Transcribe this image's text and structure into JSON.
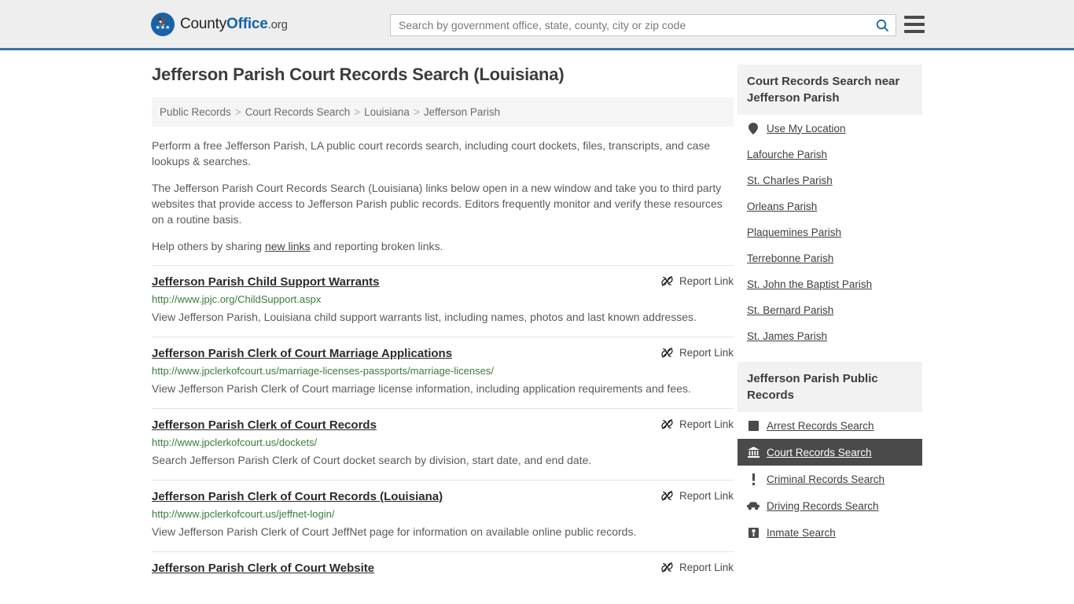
{
  "header": {
    "logo": {
      "prefix": "County",
      "bold": "Office",
      "tld": ".org",
      "icon": "eagle-logo-icon"
    },
    "search": {
      "placeholder": "Search by government office, state, county, city or zip code",
      "value": ""
    },
    "menu_label": "menu"
  },
  "page": {
    "title": "Jefferson Parish Court Records Search (Louisiana)"
  },
  "breadcrumb": [
    "Public Records",
    "Court Records Search",
    "Louisiana",
    "Jefferson Parish"
  ],
  "intro": {
    "p1": "Perform a free Jefferson Parish, LA public court records search, including court dockets, files, transcripts, and case lookups & searches.",
    "p2": "The Jefferson Parish Court Records Search (Louisiana) links below open in a new window and take you to third party websites that provide access to Jefferson Parish public records. Editors frequently monitor and verify these resources on a routine basis.",
    "p3_before": "Help others by sharing ",
    "p3_link": "new links",
    "p3_after": " and reporting broken links."
  },
  "report_link_label": "Report Link",
  "results": [
    {
      "title": "Jefferson Parish Child Support Warrants",
      "url": "http://www.jpjc.org/ChildSupport.aspx",
      "desc": "View Jefferson Parish, Louisiana child support warrants list, including names, photos and last known addresses."
    },
    {
      "title": "Jefferson Parish Clerk of Court Marriage Applications",
      "url": "http://www.jpclerkofcourt.us/marriage-licenses-passports/marriage-licenses/",
      "desc": "View Jefferson Parish Clerk of Court marriage license information, including application requirements and fees."
    },
    {
      "title": "Jefferson Parish Clerk of Court Records",
      "url": "http://www.jpclerkofcourt.us/dockets/",
      "desc": "Search Jefferson Parish Clerk of Court docket search by division, start date, and end date."
    },
    {
      "title": "Jefferson Parish Clerk of Court Records (Louisiana)",
      "url": "http://www.jpclerkofcourt.us/jeffnet-login/",
      "desc": "View Jefferson Parish Clerk of Court JeffNet page for information on available online public records."
    },
    {
      "title": "Jefferson Parish Clerk of Court Website",
      "url": "",
      "desc": ""
    }
  ],
  "sidebar": {
    "nearby": {
      "heading": "Court Records Search near Jefferson Parish",
      "items": [
        {
          "label": "Use My Location",
          "icon": "map-pin-icon"
        },
        {
          "label": "Lafourche Parish",
          "icon": ""
        },
        {
          "label": "St. Charles Parish",
          "icon": ""
        },
        {
          "label": "Orleans Parish",
          "icon": ""
        },
        {
          "label": "Plaquemines Parish",
          "icon": ""
        },
        {
          "label": "Terrebonne Parish",
          "icon": ""
        },
        {
          "label": "St. John the Baptist Parish",
          "icon": ""
        },
        {
          "label": "St. Bernard Parish",
          "icon": ""
        },
        {
          "label": "St. James Parish",
          "icon": ""
        }
      ]
    },
    "public_records": {
      "heading": "Jefferson Parish Public Records",
      "items": [
        {
          "label": "Arrest Records Search",
          "icon": "square-icon",
          "active": false
        },
        {
          "label": "Court Records Search",
          "icon": "courthouse-icon",
          "active": true
        },
        {
          "label": "Criminal Records Search",
          "icon": "exclamation-icon",
          "active": false
        },
        {
          "label": "Driving Records Search",
          "icon": "car-icon",
          "active": false
        },
        {
          "label": "Inmate Search",
          "icon": "inmate-icon",
          "active": false
        }
      ]
    }
  },
  "colors": {
    "brand_blue": "#1763a8",
    "header_border": "#3a74a8",
    "url_green": "#3a7d3a",
    "active_bg": "#4a4a4a"
  }
}
